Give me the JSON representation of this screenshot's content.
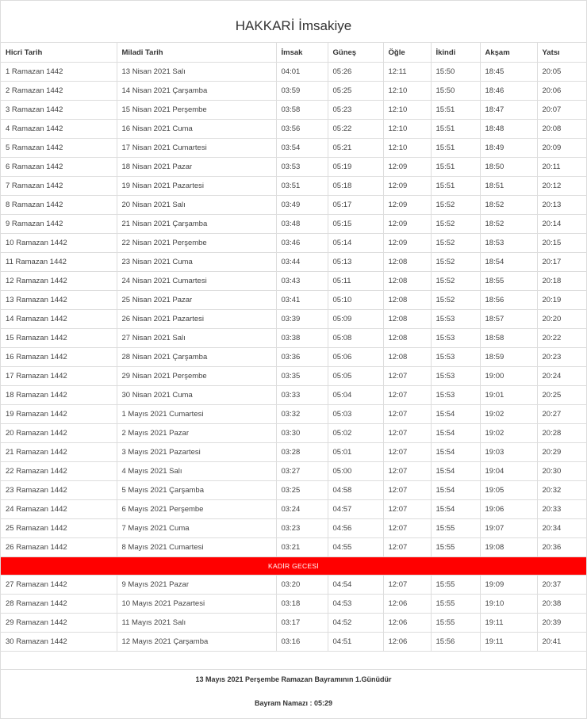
{
  "title": "HAKKARİ İmsakiye",
  "headers": [
    "Hicri Tarih",
    "Miladi Tarih",
    "İmsak",
    "Güneş",
    "Öğle",
    "İkindi",
    "Akşam",
    "Yatsı"
  ],
  "rows_before": [
    [
      "1 Ramazan 1442",
      "13 Nisan 2021 Salı",
      "04:01",
      "05:26",
      "12:11",
      "15:50",
      "18:45",
      "20:05"
    ],
    [
      "2 Ramazan 1442",
      "14 Nisan 2021 Çarşamba",
      "03:59",
      "05:25",
      "12:10",
      "15:50",
      "18:46",
      "20:06"
    ],
    [
      "3 Ramazan 1442",
      "15 Nisan 2021 Perşembe",
      "03:58",
      "05:23",
      "12:10",
      "15:51",
      "18:47",
      "20:07"
    ],
    [
      "4 Ramazan 1442",
      "16 Nisan 2021 Cuma",
      "03:56",
      "05:22",
      "12:10",
      "15:51",
      "18:48",
      "20:08"
    ],
    [
      "5 Ramazan 1442",
      "17 Nisan 2021 Cumartesi",
      "03:54",
      "05:21",
      "12:10",
      "15:51",
      "18:49",
      "20:09"
    ],
    [
      "6 Ramazan 1442",
      "18 Nisan 2021 Pazar",
      "03:53",
      "05:19",
      "12:09",
      "15:51",
      "18:50",
      "20:11"
    ],
    [
      "7 Ramazan 1442",
      "19 Nisan 2021 Pazartesi",
      "03:51",
      "05:18",
      "12:09",
      "15:51",
      "18:51",
      "20:12"
    ],
    [
      "8 Ramazan 1442",
      "20 Nisan 2021 Salı",
      "03:49",
      "05:17",
      "12:09",
      "15:52",
      "18:52",
      "20:13"
    ],
    [
      "9 Ramazan 1442",
      "21 Nisan 2021 Çarşamba",
      "03:48",
      "05:15",
      "12:09",
      "15:52",
      "18:52",
      "20:14"
    ],
    [
      "10 Ramazan 1442",
      "22 Nisan 2021 Perşembe",
      "03:46",
      "05:14",
      "12:09",
      "15:52",
      "18:53",
      "20:15"
    ],
    [
      "11 Ramazan 1442",
      "23 Nisan 2021 Cuma",
      "03:44",
      "05:13",
      "12:08",
      "15:52",
      "18:54",
      "20:17"
    ],
    [
      "12 Ramazan 1442",
      "24 Nisan 2021 Cumartesi",
      "03:43",
      "05:11",
      "12:08",
      "15:52",
      "18:55",
      "20:18"
    ],
    [
      "13 Ramazan 1442",
      "25 Nisan 2021 Pazar",
      "03:41",
      "05:10",
      "12:08",
      "15:52",
      "18:56",
      "20:19"
    ],
    [
      "14 Ramazan 1442",
      "26 Nisan 2021 Pazartesi",
      "03:39",
      "05:09",
      "12:08",
      "15:53",
      "18:57",
      "20:20"
    ],
    [
      "15 Ramazan 1442",
      "27 Nisan 2021 Salı",
      "03:38",
      "05:08",
      "12:08",
      "15:53",
      "18:58",
      "20:22"
    ],
    [
      "16 Ramazan 1442",
      "28 Nisan 2021 Çarşamba",
      "03:36",
      "05:06",
      "12:08",
      "15:53",
      "18:59",
      "20:23"
    ],
    [
      "17 Ramazan 1442",
      "29 Nisan 2021 Perşembe",
      "03:35",
      "05:05",
      "12:07",
      "15:53",
      "19:00",
      "20:24"
    ],
    [
      "18 Ramazan 1442",
      "30 Nisan 2021 Cuma",
      "03:33",
      "05:04",
      "12:07",
      "15:53",
      "19:01",
      "20:25"
    ],
    [
      "19 Ramazan 1442",
      "1 Mayıs 2021 Cumartesi",
      "03:32",
      "05:03",
      "12:07",
      "15:54",
      "19:02",
      "20:27"
    ],
    [
      "20 Ramazan 1442",
      "2 Mayıs 2021 Pazar",
      "03:30",
      "05:02",
      "12:07",
      "15:54",
      "19:02",
      "20:28"
    ],
    [
      "21 Ramazan 1442",
      "3 Mayıs 2021 Pazartesi",
      "03:28",
      "05:01",
      "12:07",
      "15:54",
      "19:03",
      "20:29"
    ],
    [
      "22 Ramazan 1442",
      "4 Mayıs 2021 Salı",
      "03:27",
      "05:00",
      "12:07",
      "15:54",
      "19:04",
      "20:30"
    ],
    [
      "23 Ramazan 1442",
      "5 Mayıs 2021 Çarşamba",
      "03:25",
      "04:58",
      "12:07",
      "15:54",
      "19:05",
      "20:32"
    ],
    [
      "24 Ramazan 1442",
      "6 Mayıs 2021 Perşembe",
      "03:24",
      "04:57",
      "12:07",
      "15:54",
      "19:06",
      "20:33"
    ],
    [
      "25 Ramazan 1442",
      "7 Mayıs 2021 Cuma",
      "03:23",
      "04:56",
      "12:07",
      "15:55",
      "19:07",
      "20:34"
    ],
    [
      "26 Ramazan 1442",
      "8 Mayıs 2021 Cumartesi",
      "03:21",
      "04:55",
      "12:07",
      "15:55",
      "19:08",
      "20:36"
    ]
  ],
  "special_row": "KADİR GECESİ",
  "rows_after": [
    [
      "27 Ramazan 1442",
      "9 Mayıs 2021 Pazar",
      "03:20",
      "04:54",
      "12:07",
      "15:55",
      "19:09",
      "20:37"
    ],
    [
      "28 Ramazan 1442",
      "10 Mayıs 2021 Pazartesi",
      "03:18",
      "04:53",
      "12:06",
      "15:55",
      "19:10",
      "20:38"
    ],
    [
      "29 Ramazan 1442",
      "11 Mayıs 2021 Salı",
      "03:17",
      "04:52",
      "12:06",
      "15:55",
      "19:11",
      "20:39"
    ],
    [
      "30 Ramazan 1442",
      "12 Mayıs 2021 Çarşamba",
      "03:16",
      "04:51",
      "12:06",
      "15:56",
      "19:11",
      "20:41"
    ]
  ],
  "footer": {
    "bayram_note": "13 Mayıs 2021 Perşembe Ramazan Bayramının 1.Günüdür",
    "bayram_namazi": "Bayram Namazı : 05:29"
  },
  "colors": {
    "special_row_bg": "#ff0000",
    "special_row_text": "#ffffff",
    "border": "#dddddd"
  }
}
